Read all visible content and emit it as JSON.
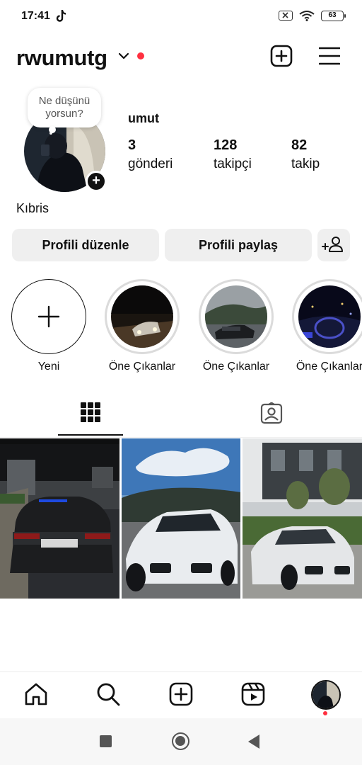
{
  "status_bar": {
    "time": "17:41",
    "battery": "63",
    "icons": [
      "tiktok-icon",
      "no-sim-icon",
      "wifi-icon",
      "battery-icon"
    ]
  },
  "header": {
    "username": "rwumutg",
    "icons": [
      "chevron-down-icon",
      "add-post-icon",
      "menu-icon"
    ],
    "notification_color": "#ff3040"
  },
  "profile": {
    "note": "Ne düşünü yorsun?",
    "display_name": "umut",
    "bio": "Kıbris",
    "stats": [
      {
        "value": "3",
        "label": "gönderi"
      },
      {
        "value": "128",
        "label": "takipçi"
      },
      {
        "value": "82",
        "label": "takip"
      }
    ]
  },
  "buttons": {
    "edit_profile": "Profili düzenle",
    "share_profile": "Profili paylaş",
    "discover_people_icon": "add-person-icon"
  },
  "highlights": [
    {
      "label": "Yeni"
    },
    {
      "label": "Öne Çıkanlar"
    },
    {
      "label": "Öne Çıkanlar"
    },
    {
      "label": "Öne Çıkanlar"
    }
  ],
  "tabs": {
    "active": "grid",
    "icons": [
      "grid-icon",
      "tagged-icon"
    ]
  },
  "posts": [
    "bmw-black-night",
    "bmw-white-sunset",
    "bmw-white-building"
  ],
  "bottom_nav": {
    "icons": [
      "home-icon",
      "search-icon",
      "create-icon",
      "reels-icon",
      "profile-avatar"
    ]
  },
  "colors": {
    "accent": "#ff3040",
    "button_bg": "#efefef",
    "text": "#111111"
  }
}
